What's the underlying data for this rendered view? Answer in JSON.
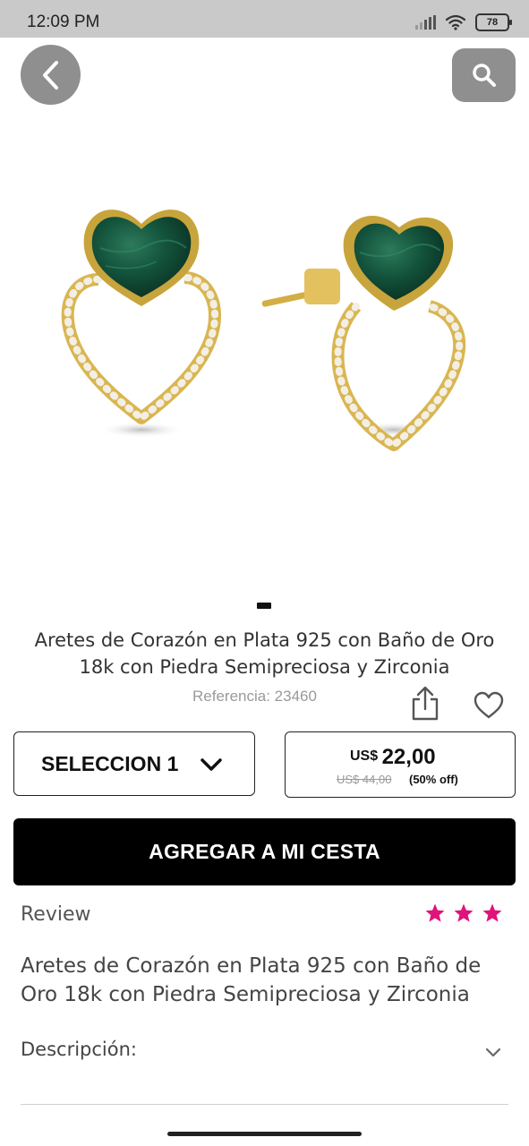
{
  "status_bar": {
    "time": "12:09 PM",
    "battery": "78"
  },
  "product": {
    "title": "Aretes de Corazón en Plata 925 con Baño de Oro 18k con Piedra Semipreciosa y Zirconia",
    "reference": "Referencia: 23460",
    "image_icon": "heart-earrings-image",
    "gallery_index": 1,
    "gallery_count": 1
  },
  "selector": {
    "value": "SELECCION 1"
  },
  "price": {
    "currency": "US$",
    "value": "22,00",
    "old": "US$ 44,00",
    "discount": "(50% off)"
  },
  "add_to_cart": {
    "label": "AGREGAR A MI CESTA"
  },
  "review": {
    "label": "Review",
    "stars": 3,
    "star_color": "#e0137a"
  },
  "description": {
    "title": "Aretes de Corazón en Plata 925 con Baño de Oro 18k con Piedra Semipreciosa y Zirconia",
    "section_label": "Descripción:"
  },
  "icons": {
    "back": "chevron-left-icon",
    "search": "search-icon",
    "share": "share-icon",
    "favorite": "heart-icon",
    "select": "chevron-down-icon",
    "expand": "chevron-down-icon"
  }
}
